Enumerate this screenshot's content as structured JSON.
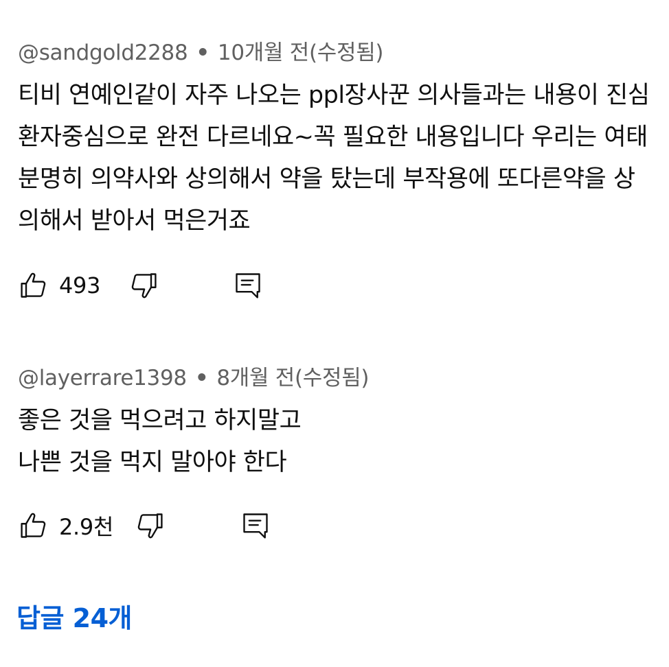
{
  "comments": [
    {
      "author": "@sandgold2288",
      "separator": "•",
      "time": "10개월 전(수정됨)",
      "text": "티비 연예인같이 자주 나오는 ppl장사꾼 의사들과는 내용이 진심 환자중심으로 완전 다르네요~꼭 필요한 내용입니다 우리는 여태 분명히 의약사와 상의해서 약을 탔는데 부작용에 또다른약을 상의해서 받아서 먹은거죠",
      "likes": "493",
      "icons": {
        "like": "thumb-up-icon",
        "dislike": "thumb-down-icon",
        "reply": "reply-comment-icon"
      }
    },
    {
      "author": "@layerrare1398",
      "separator": "•",
      "time": "8개월 전(수정됨)",
      "text": "좋은 것을 먹으려고 하지말고\n나쁜 것을 먹지 말아야 한다",
      "likes": "2.9천",
      "icons": {
        "like": "thumb-up-icon",
        "dislike": "thumb-down-icon",
        "reply": "reply-comment-icon"
      }
    }
  ],
  "replies_link": "답글 24개",
  "colors": {
    "text": "#0f0f0f",
    "meta": "#606060",
    "link": "#065fd4",
    "background": "#ffffff"
  }
}
